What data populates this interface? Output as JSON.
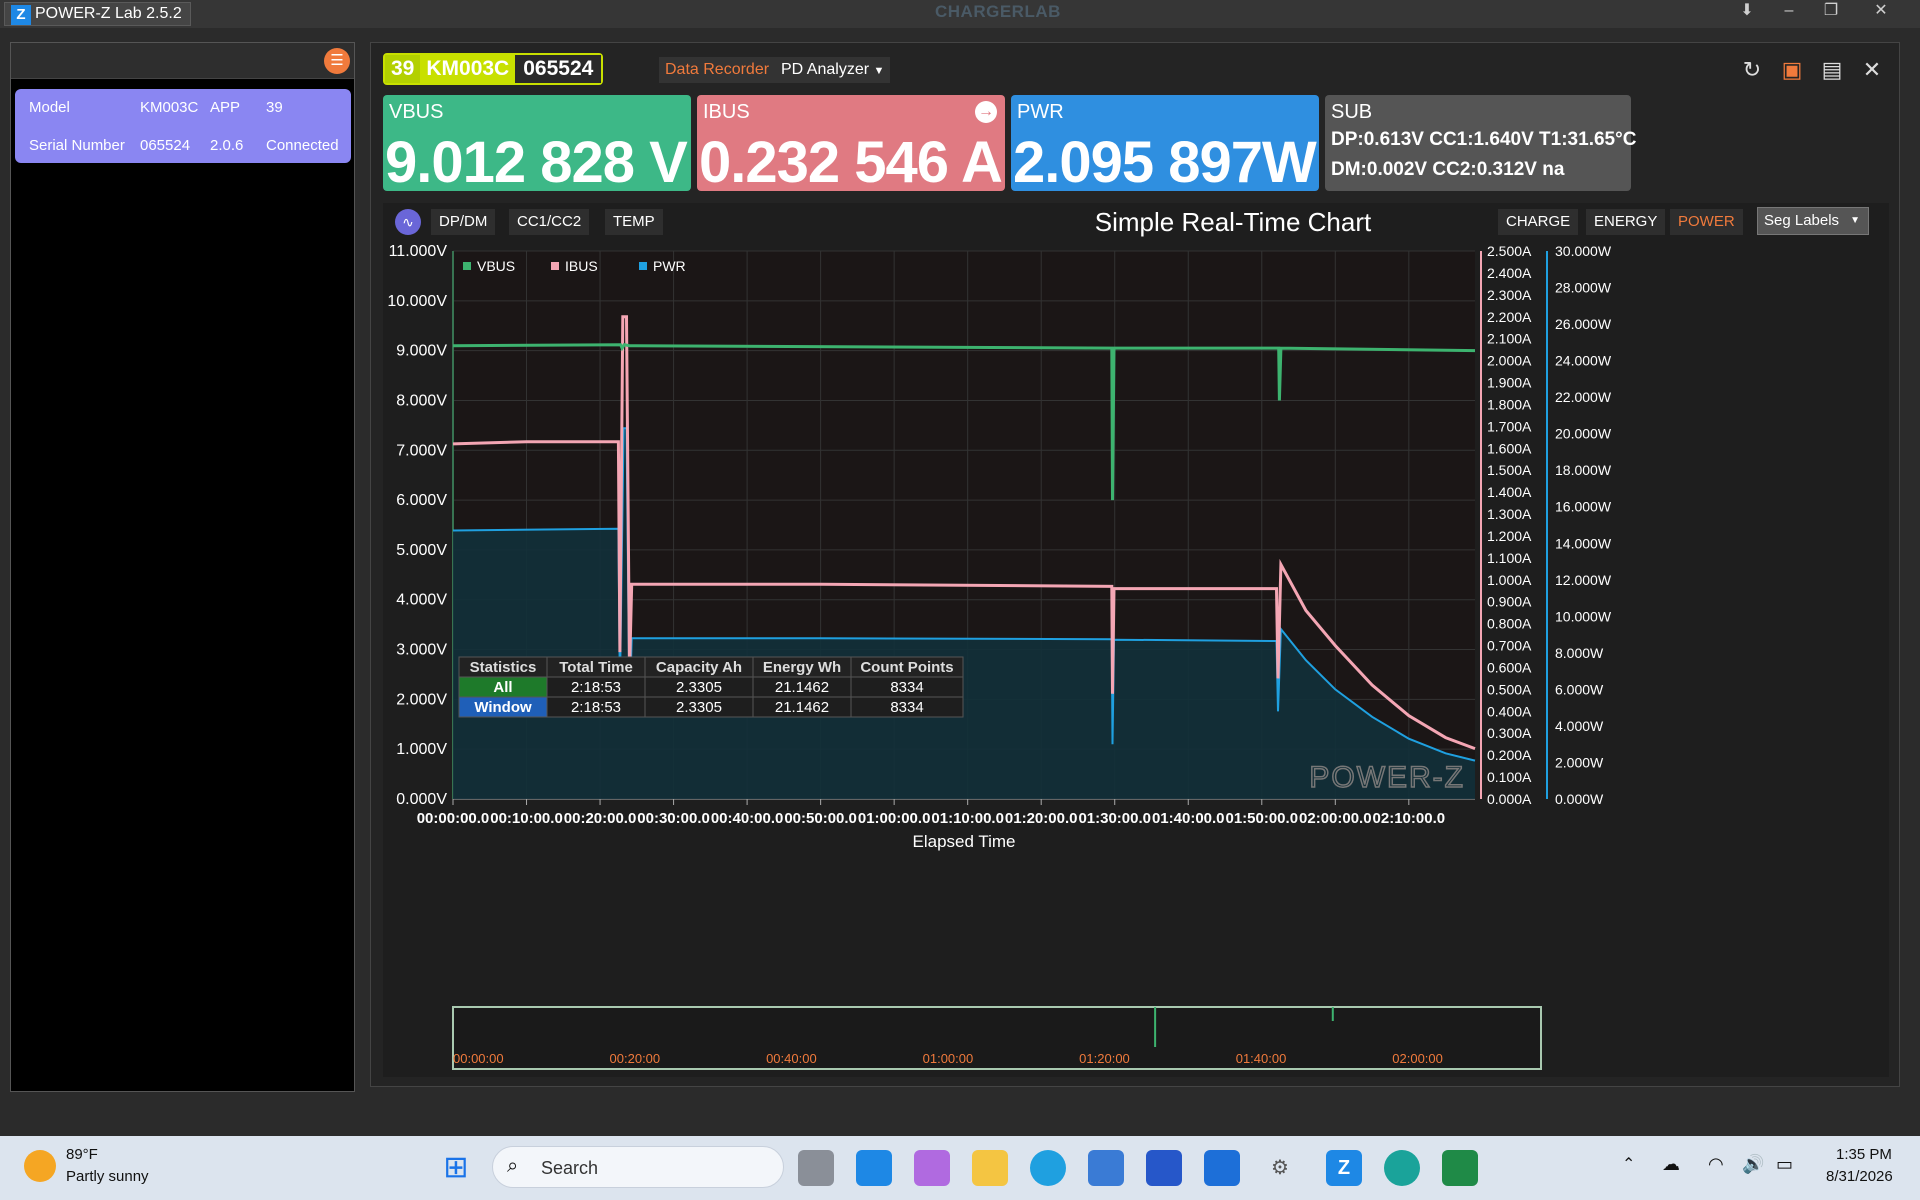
{
  "app": {
    "title": "POWER-Z Lab 2.5.2",
    "brand": "CHARGERLAB"
  },
  "device": {
    "labels": {
      "model": "Model",
      "serial": "Serial Number"
    },
    "model": "KM003C",
    "app_label": "APP",
    "app_version": "39",
    "serial": "065524",
    "fw": "2.0.6",
    "status": "Connected"
  },
  "devtag": {
    "num": "39",
    "model": "KM003C",
    "serial": "065524"
  },
  "tabs": {
    "recorder": "Data Recorder",
    "pd": "PD Analyzer"
  },
  "meters": {
    "vbus": {
      "label": "VBUS",
      "value": "9.012 828 V",
      "color": "#3db887"
    },
    "ibus": {
      "label": "IBUS",
      "value": "0.232 546 A",
      "color": "#e07a82"
    },
    "pwr": {
      "label": "PWR",
      "value": "2.095 897W",
      "color": "#2f8fe0"
    },
    "sub": {
      "label": "SUB",
      "line1": "DP:0.613V   CC1:1.640V   T1:31.65°C",
      "line2": "DM:0.002V   CC2:0.312V   na"
    }
  },
  "chart_toolbar": {
    "tabs": [
      "DP/DM",
      "CC1/CC2",
      "TEMP"
    ],
    "title": "Simple Real-Time Chart",
    "right_tabs": [
      "CHARGE",
      "ENERGY",
      "POWER"
    ],
    "active_right": "POWER",
    "seg_select": "Seg Labels"
  },
  "chart_data": {
    "type": "line",
    "title": "Simple Real-Time Chart",
    "xlabel": "Elapsed Time",
    "x_ticks": [
      "00:00:00.0",
      "00:10:00.0",
      "00:20:00.0",
      "00:30:00.0",
      "00:40:00.0",
      "00:50:00.0",
      "01:00:00.0",
      "01:10:00.0",
      "01:20:00.0",
      "01:30:00.0",
      "01:40:00.0",
      "01:50:00.0",
      "02:00:00.0",
      "02:10:00.0"
    ],
    "xlim_min": [
      0,
      139
    ],
    "left_axis": {
      "ticks": [
        "0.000V",
        "1.000V",
        "2.000V",
        "3.000V",
        "4.000V",
        "5.000V",
        "6.000V",
        "7.000V",
        "8.000V",
        "9.000V",
        "10.000V",
        "11.000V"
      ],
      "ylim": [
        0,
        11
      ]
    },
    "mid_axis": {
      "ticks": [
        "0.000A",
        "0.100A",
        "0.200A",
        "0.300A",
        "0.400A",
        "0.500A",
        "0.600A",
        "0.700A",
        "0.800A",
        "0.900A",
        "1.000A",
        "1.100A",
        "1.200A",
        "1.300A",
        "1.400A",
        "1.500A",
        "1.600A",
        "1.700A",
        "1.800A",
        "1.900A",
        "2.000A",
        "2.100A",
        "2.200A",
        "2.300A",
        "2.400A",
        "2.500A"
      ],
      "ylim": [
        0,
        2.5
      ]
    },
    "right_axis": {
      "ticks": [
        "0.000W",
        "2.000W",
        "4.000W",
        "6.000W",
        "8.000W",
        "10.000W",
        "12.000W",
        "14.000W",
        "16.000W",
        "18.000W",
        "20.000W",
        "22.000W",
        "24.000W",
        "26.000W",
        "28.000W",
        "30.000W"
      ],
      "ylim": [
        0,
        30
      ]
    },
    "legend": [
      "VBUS",
      "IBUS",
      "PWR"
    ],
    "legend_placement": "top-left",
    "series": [
      {
        "name": "VBUS",
        "color": "#3db36f",
        "axis": "left",
        "points": [
          [
            0,
            9.1
          ],
          [
            22.8,
            9.12
          ],
          [
            23,
            9.05
          ],
          [
            23.3,
            9.12
          ],
          [
            24,
            9.1
          ],
          [
            89.6,
            9.05
          ],
          [
            89.7,
            6.0
          ],
          [
            89.9,
            9.05
          ],
          [
            112.3,
            9.05
          ],
          [
            112.4,
            8.0
          ],
          [
            112.6,
            9.05
          ],
          [
            139,
            9.0
          ]
        ]
      },
      {
        "name": "IBUS",
        "color": "#f4a6b4",
        "axis": "mid",
        "points": [
          [
            0,
            1.62
          ],
          [
            10,
            1.63
          ],
          [
            22.5,
            1.63
          ],
          [
            22.7,
            0.67
          ],
          [
            23.1,
            2.2
          ],
          [
            23.6,
            2.2
          ],
          [
            24,
            0.58
          ],
          [
            24.3,
            0.98
          ],
          [
            50,
            0.98
          ],
          [
            89.6,
            0.97
          ],
          [
            89.7,
            0.48
          ],
          [
            89.9,
            0.96
          ],
          [
            112,
            0.96
          ],
          [
            112.2,
            0.55
          ],
          [
            112.6,
            1.07
          ],
          [
            116,
            0.86
          ],
          [
            120,
            0.7
          ],
          [
            125,
            0.52
          ],
          [
            130,
            0.38
          ],
          [
            135,
            0.28
          ],
          [
            139,
            0.23
          ]
        ]
      },
      {
        "name": "PWR",
        "color": "#1fa0e0",
        "axis": "right",
        "points": [
          [
            0,
            14.7
          ],
          [
            22.5,
            14.8
          ],
          [
            22.7,
            5.9
          ],
          [
            23.2,
            20.3
          ],
          [
            23.6,
            20.3
          ],
          [
            24,
            4.8
          ],
          [
            24.3,
            8.8
          ],
          [
            50,
            8.8
          ],
          [
            89.6,
            8.75
          ],
          [
            89.7,
            3.0
          ],
          [
            89.9,
            8.72
          ],
          [
            112,
            8.65
          ],
          [
            112.2,
            4.8
          ],
          [
            112.6,
            9.3
          ],
          [
            116,
            7.6
          ],
          [
            120,
            6.0
          ],
          [
            125,
            4.5
          ],
          [
            130,
            3.3
          ],
          [
            135,
            2.5
          ],
          [
            139,
            2.1
          ]
        ]
      }
    ]
  },
  "statistics": {
    "headers": [
      "Statistics",
      "Total Time",
      "Capacity Ah",
      "Energy Wh",
      "Count Points"
    ],
    "rows": [
      [
        "All",
        "2:18:53",
        "2.3305",
        "21.1462",
        "8334"
      ],
      [
        "Window",
        "2:18:53",
        "2.3305",
        "21.1462",
        "8334"
      ]
    ]
  },
  "watermark": "POWER-Z",
  "overview_ticks": [
    "00:00:00",
    "00:20:00",
    "00:40:00",
    "01:00:00",
    "01:20:00",
    "01:40:00",
    "02:00:00"
  ],
  "taskbar": {
    "weather_temp": "89°F",
    "weather_desc": "Partly sunny",
    "search": "Search",
    "time": "1:35 PM",
    "date": "8/31/2026"
  }
}
